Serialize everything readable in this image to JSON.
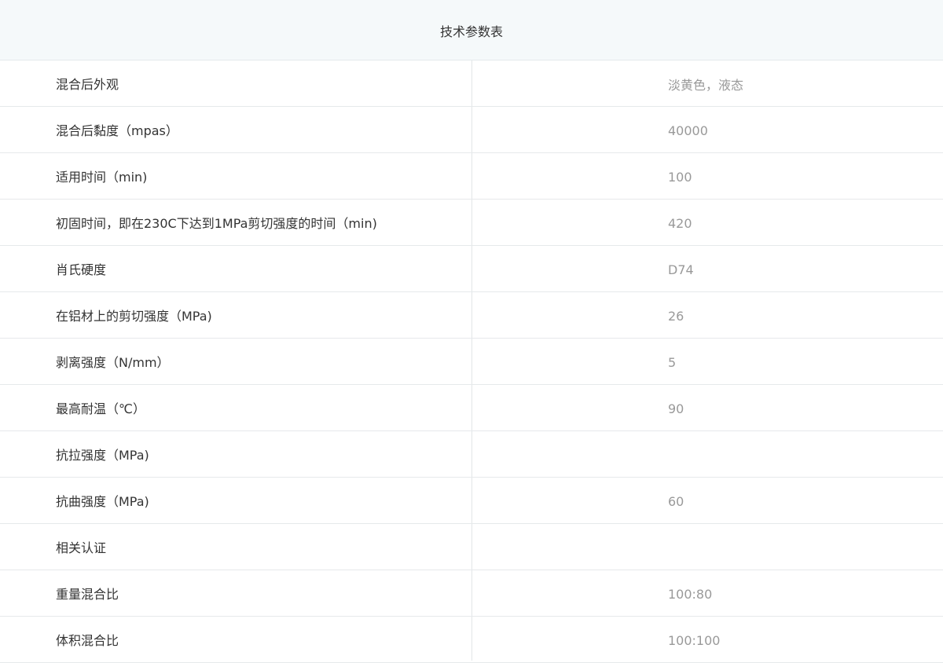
{
  "table": {
    "title": "技术参数表",
    "rows": [
      {
        "name": "混合后外观",
        "value": "淡黄色，液态"
      },
      {
        "name": "混合后黏度（mpas）",
        "value": "40000"
      },
      {
        "name": "适用时间（min)",
        "value": "100"
      },
      {
        "name": "初固时间，即在230C下达到1MPa剪切强度的时间（min)",
        "value": "420"
      },
      {
        "name": "肖氏硬度",
        "value": "D74"
      },
      {
        "name": "在铝材上的剪切强度（MPa)",
        "value": "26"
      },
      {
        "name": "剥离强度（N/mm）",
        "value": "5"
      },
      {
        "name": "最高耐温（℃）",
        "value": "90"
      },
      {
        "name": "抗拉强度（MPa)",
        "value": ""
      },
      {
        "name": "抗曲强度（MPa)",
        "value": "60"
      },
      {
        "name": "相关认证",
        "value": ""
      },
      {
        "name": "重量混合比",
        "value": "100:80"
      },
      {
        "name": "体积混合比",
        "value": "100:100"
      }
    ]
  }
}
